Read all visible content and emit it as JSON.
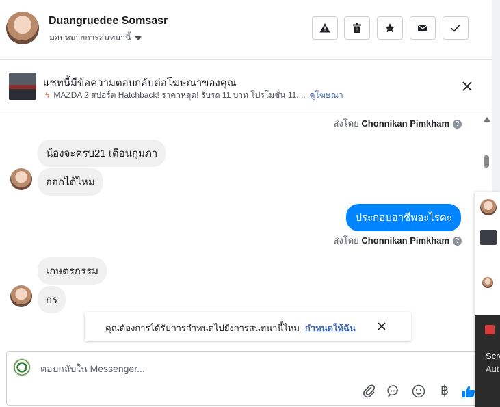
{
  "header": {
    "contact_name": "Duangruedee Somsasr",
    "assign_label": "มอบหมายการสนทนานี้",
    "tools": [
      {
        "name": "report-spam-button",
        "icon": "warning-icon"
      },
      {
        "name": "delete-button",
        "icon": "trash-icon"
      },
      {
        "name": "star-button",
        "icon": "star-icon"
      },
      {
        "name": "mark-unread-button",
        "icon": "envelope-icon"
      },
      {
        "name": "mark-done-button",
        "icon": "check-icon"
      }
    ]
  },
  "ad_bar": {
    "title": "แชทนี้มีข้อความตอบกลับต่อโฆษณาของคุณ",
    "ad_text": "MAZDA 2 สปอร์ต Hatchback! ราคาหลุด! รับรถ 11 บาท โปรโมชั่น 11....",
    "view_ad_link": "ดูโฆษณา"
  },
  "messages": {
    "sent_by_prefix": "ส่งโดย",
    "sent_by_name": "Chonnikan Pimkham",
    "help_glyph": "?",
    "incoming_1": "น้องจะครบ21 เดือนกุมภา",
    "incoming_2": "ออกได้ไหม",
    "outgoing_1": "ประกอบอาชีพอะไรคะ",
    "incoming_3": "เกษตรกรรม",
    "incoming_4": "กร"
  },
  "reminder": {
    "text": "คุณต้องการได้รับการกำหนดไปยังการสนทนานี้ไหม",
    "link": "กำหนดให้ฉัน"
  },
  "composer": {
    "placeholder": "ตอบกลับใน Messenger...",
    "currency_glyph": "฿"
  },
  "side_panel": {
    "text_1": "Scre",
    "text_2": "Aut"
  },
  "colors": {
    "outgoing_bubble": "#0084ff",
    "incoming_bubble": "#f1f0f0",
    "link": "#4267b2",
    "like": "#0084ff"
  }
}
